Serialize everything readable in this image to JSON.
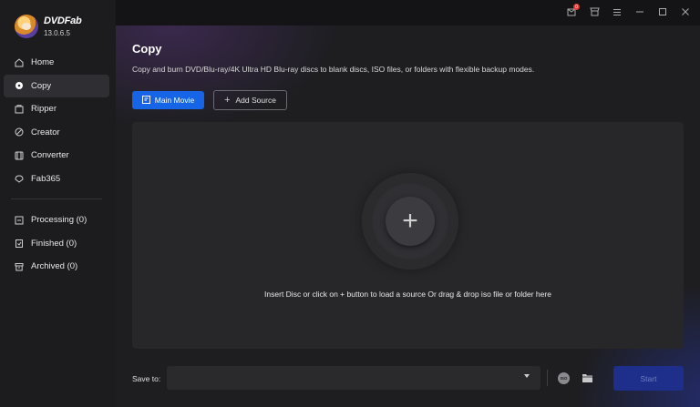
{
  "app": {
    "name": "DVDFab",
    "version": "13.0.6.5"
  },
  "sidebar": {
    "items": [
      {
        "label": "Home",
        "icon": "home-icon"
      },
      {
        "label": "Copy",
        "icon": "copy-disc-icon",
        "active": true
      },
      {
        "label": "Ripper",
        "icon": "ripper-icon"
      },
      {
        "label": "Creator",
        "icon": "creator-icon"
      },
      {
        "label": "Converter",
        "icon": "converter-icon"
      },
      {
        "label": "Fab365",
        "icon": "fab365-icon"
      }
    ],
    "queue": [
      {
        "label": "Processing (0)",
        "icon": "processing-icon"
      },
      {
        "label": "Finished (0)",
        "icon": "finished-icon"
      },
      {
        "label": "Archived (0)",
        "icon": "archived-icon"
      }
    ]
  },
  "titlebar": {
    "notification_count": "0"
  },
  "main": {
    "title": "Copy",
    "description": "Copy and burn DVD/Blu-ray/4K Ultra HD Blu-ray discs to blank discs, ISO files, or folders with flexible backup modes.",
    "mode_button": "Main Movie",
    "add_source_button": "Add Source",
    "drop_hint": "Insert Disc or click on + button to load a source Or drag & drop iso file or folder here",
    "save_to_label": "Save to:",
    "save_to_value": "",
    "iso_label": "ISO",
    "start_button": "Start"
  },
  "colors": {
    "accent": "#1565e6",
    "active_nav": "#2e2e33",
    "badge": "#e53935"
  }
}
